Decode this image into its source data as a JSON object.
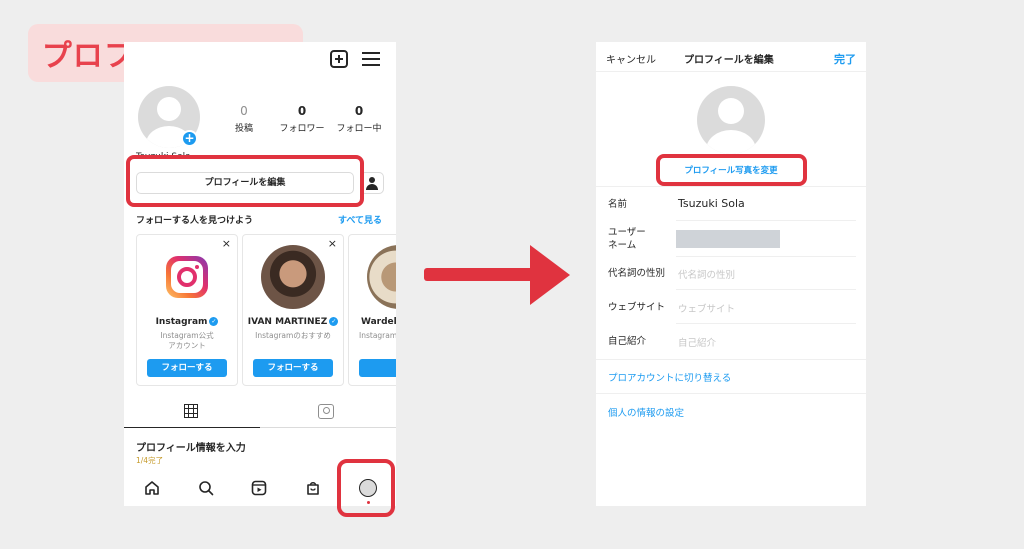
{
  "banner": {
    "title": "プロフィール画面"
  },
  "left": {
    "username": "Tsuzuki Sola",
    "stats": [
      {
        "value": "0",
        "label": "投稿"
      },
      {
        "value": "0",
        "label": "フォロワー"
      },
      {
        "value": "0",
        "label": "フォロー中"
      }
    ],
    "edit_profile": "プロフィールを編集",
    "discover_title": "フォローする人を見つけよう",
    "see_all": "すべて見る",
    "cards": [
      {
        "name": "Instagram",
        "sub1": "Instagram公式",
        "sub2": "アカウント",
        "follow": "フォローする"
      },
      {
        "name": "IVAN MARTINEZ",
        "sub1": "Instagramのおすすめ",
        "sub2": "",
        "follow": "フォローする"
      },
      {
        "name": "Wardell",
        "sub1": "Instagram",
        "sub2": "",
        "follow": "フォ"
      }
    ],
    "close_glyph": "×",
    "profile_info_title": "プロフィール情報を入力",
    "profile_info_sub": "1/4完了"
  },
  "right": {
    "cancel": "キャンセル",
    "title": "プロフィールを編集",
    "done": "完了",
    "change_photo": "プロフィール写真を変更",
    "name_label": "名前",
    "name_value": "Tsuzuki Sola",
    "username_label_1": "ユーザー",
    "username_label_2": "ネーム",
    "pronoun_label": "代名詞の性別",
    "pronoun_placeholder": "代名詞の性別",
    "website_label": "ウェブサイト",
    "website_placeholder": "ウェブサイト",
    "bio_label": "自己紹介",
    "bio_placeholder": "自己紹介",
    "pro_account": "プロアカウントに切り替える",
    "personal_info": "個人の情報の設定"
  },
  "colors": {
    "accent": "#1d9bf0",
    "highlight": "#e0333f",
    "banner_bg": "#f9dcdc"
  }
}
